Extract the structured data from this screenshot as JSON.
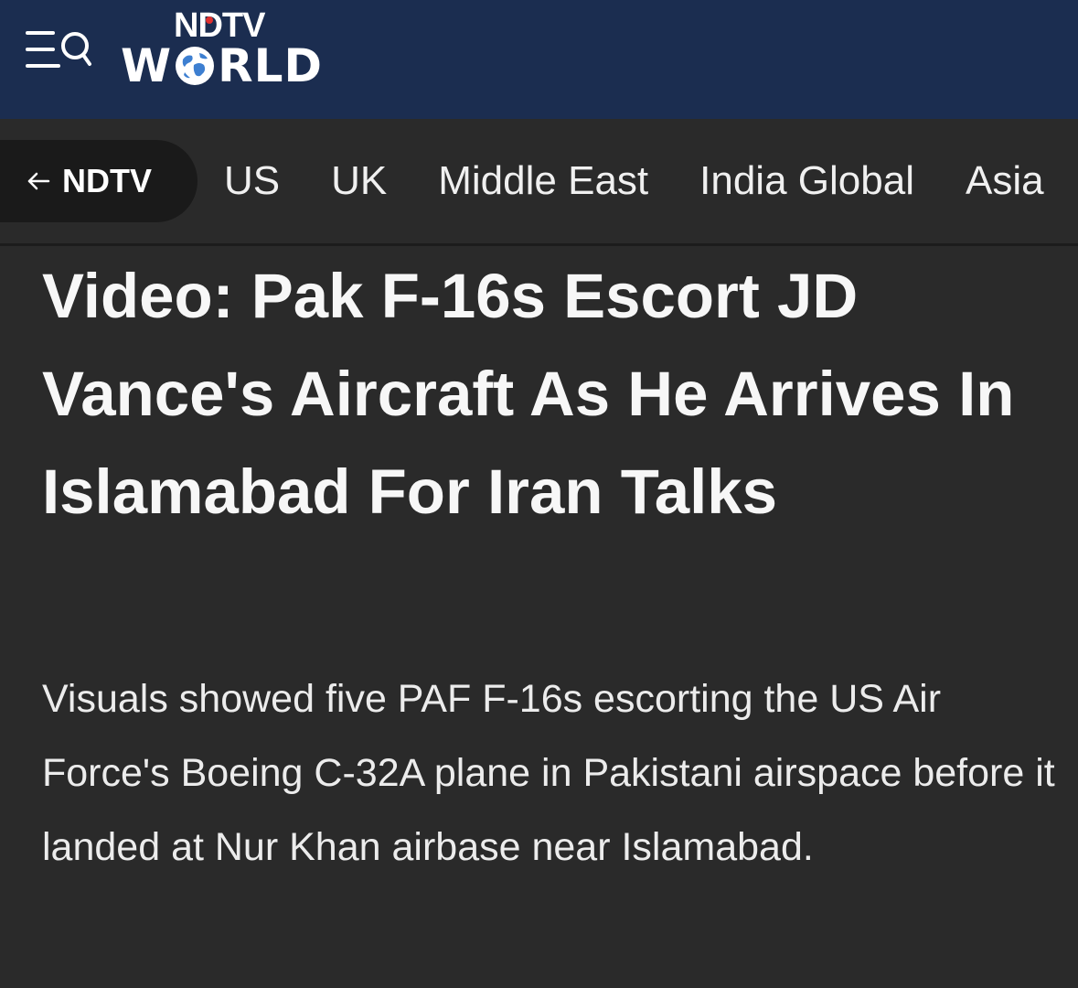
{
  "header": {
    "logo_top": "NDTV",
    "logo_bottom_left": "W",
    "logo_bottom_right": "RLD",
    "bg_color": "#1b2d50",
    "logo_dot_color": "#e0312f",
    "menu_icon": "menu-search-icon",
    "globe_icon": "globe-icon"
  },
  "section_nav": {
    "back_label": "NDTV",
    "back_icon": "arrow-left-icon",
    "items": [
      "US",
      "UK",
      "Middle East",
      "India Global",
      "Asia"
    ]
  },
  "article": {
    "headline": "Video: Pak F-16s Escort JD Vance's Aircraft As He Arrives In Islamabad For Iran Talks",
    "summary": "Visuals showed five PAF F-16s escorting the US Air Force's Boeing C-32A plane in Pakistani airspace before it landed at Nur Khan airbase near Islamabad."
  },
  "colors": {
    "page_bg": "#2a2a2a",
    "pill_bg": "#1a1a1a",
    "text": "#f2f2f2"
  }
}
